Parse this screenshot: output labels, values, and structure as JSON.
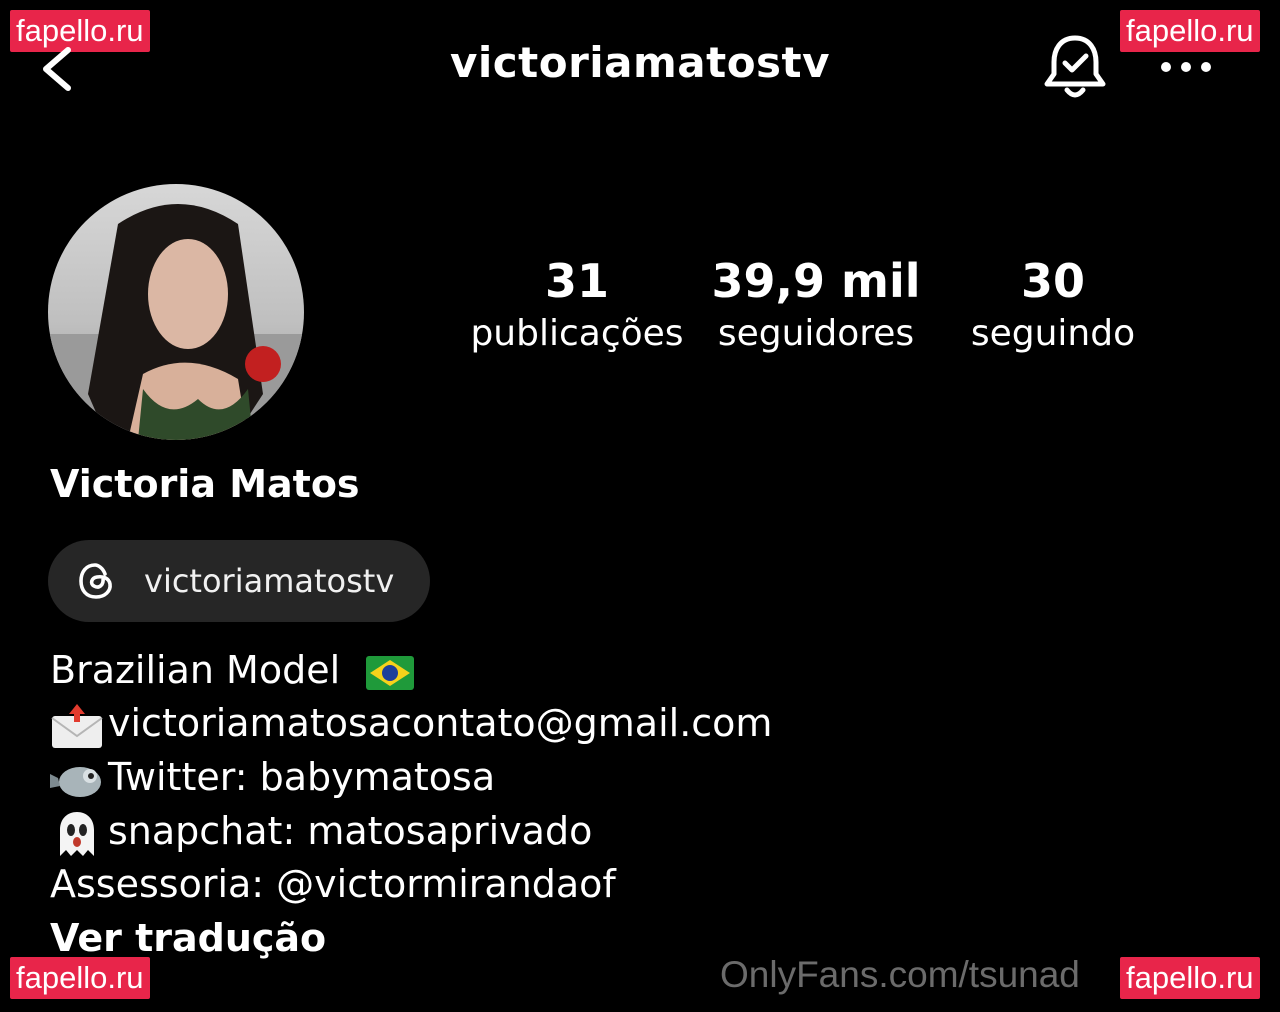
{
  "watermarks": [
    "fapello.ru",
    "fapello.ru",
    "fapello.ru",
    "fapello.ru"
  ],
  "watermark_color": "#e8254a",
  "header": {
    "username": "victoriamatostv",
    "back_icon": "chevron-left-icon",
    "bell_icon": "bell-check-icon",
    "more_icon": "more-dots-icon"
  },
  "profile": {
    "display_name": "Victoria Matos",
    "stats": [
      {
        "value": "31",
        "label": "publicações"
      },
      {
        "value": "39,9 mil",
        "label": "seguidores"
      },
      {
        "value": "30",
        "label": "seguindo"
      }
    ],
    "threads_badge": {
      "icon": "threads-icon",
      "label": "victoriamatostv"
    },
    "bio": [
      {
        "emoji": "",
        "text": "Brazilian Model",
        "trailing_emoji": "brazil-flag-icon"
      },
      {
        "emoji": "envelope-icon",
        "text": "victoriamatosacontato@gmail.com"
      },
      {
        "emoji": "bird-icon",
        "text": "Twitter: babymatosa"
      },
      {
        "emoji": "ghost-icon",
        "text": "snapchat: matosaprivado"
      },
      {
        "emoji": "",
        "text": "Assessoria: @victormirandaof"
      },
      {
        "emoji": "",
        "text": "Ver tradução"
      }
    ]
  },
  "overlay_text": "OnlyFans.com/tsunad"
}
